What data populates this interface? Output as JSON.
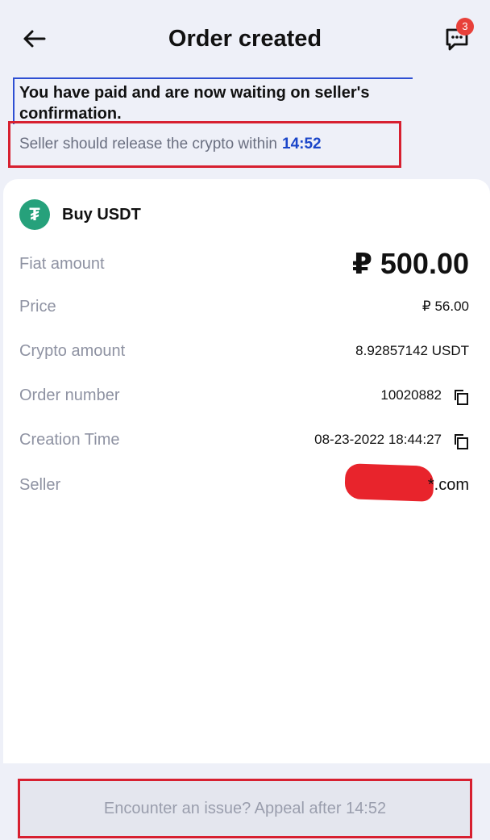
{
  "header": {
    "title": "Order created",
    "chat_badge_count": "3"
  },
  "status": {
    "message": "You have paid and are now waiting on seller's confirmation.",
    "release_prefix": "Seller should release the crypto within",
    "release_time": "14:52"
  },
  "coin": {
    "label": "Buy USDT",
    "icon_glyph": "₮"
  },
  "details": {
    "fiat_amount_label": "Fiat amount",
    "fiat_amount_value": "₽ 500.00",
    "price_label": "Price",
    "price_value": "₽ 56.00",
    "crypto_amount_label": "Crypto amount",
    "crypto_amount_value": "8.92857142 USDT",
    "order_number_label": "Order number",
    "order_number_value": "10020882",
    "creation_time_label": "Creation Time",
    "creation_time_value": "08-23-2022 18:44:27",
    "seller_label": "Seller",
    "seller_value": "*.com"
  },
  "footer": {
    "appeal_label": "Encounter an issue? Appeal after 14:52"
  },
  "colors": {
    "accent_blue": "#1b46c9",
    "highlight_red": "#d72030",
    "tether_green": "#26a17b"
  }
}
